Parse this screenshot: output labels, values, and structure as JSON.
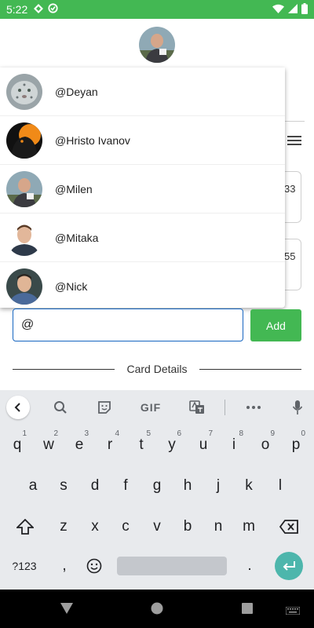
{
  "status_bar": {
    "time": "5:22"
  },
  "mention_suggestions": [
    {
      "label": "@Deyan"
    },
    {
      "label": "@Hristo Ivanov"
    },
    {
      "label": "@Milen"
    },
    {
      "label": "@Mitaka"
    },
    {
      "label": "@Nick"
    }
  ],
  "background_cards": [
    {
      "partial_text": "33"
    },
    {
      "partial_text": "55"
    }
  ],
  "mention_input": {
    "value": "@"
  },
  "add_button": {
    "label": "Add"
  },
  "section_divider": {
    "label": "Card Details"
  },
  "keyboard": {
    "toolbar": {
      "gif_label": "GIF"
    },
    "row1": [
      {
        "k": "q",
        "h": "1"
      },
      {
        "k": "w",
        "h": "2"
      },
      {
        "k": "e",
        "h": "3"
      },
      {
        "k": "r",
        "h": "4"
      },
      {
        "k": "t",
        "h": "5"
      },
      {
        "k": "y",
        "h": "6"
      },
      {
        "k": "u",
        "h": "7"
      },
      {
        "k": "i",
        "h": "8"
      },
      {
        "k": "o",
        "h": "9"
      },
      {
        "k": "p",
        "h": "0"
      }
    ],
    "row2": [
      "a",
      "s",
      "d",
      "f",
      "g",
      "h",
      "j",
      "k",
      "l"
    ],
    "row3": [
      "z",
      "x",
      "c",
      "v",
      "b",
      "n",
      "m"
    ],
    "symbols_label": "?123",
    "comma": ",",
    "period": "."
  },
  "colors": {
    "status_bar": "#43b853",
    "add_button": "#43b853",
    "input_border": "#1565c0",
    "enter_key": "#4db6ac"
  }
}
